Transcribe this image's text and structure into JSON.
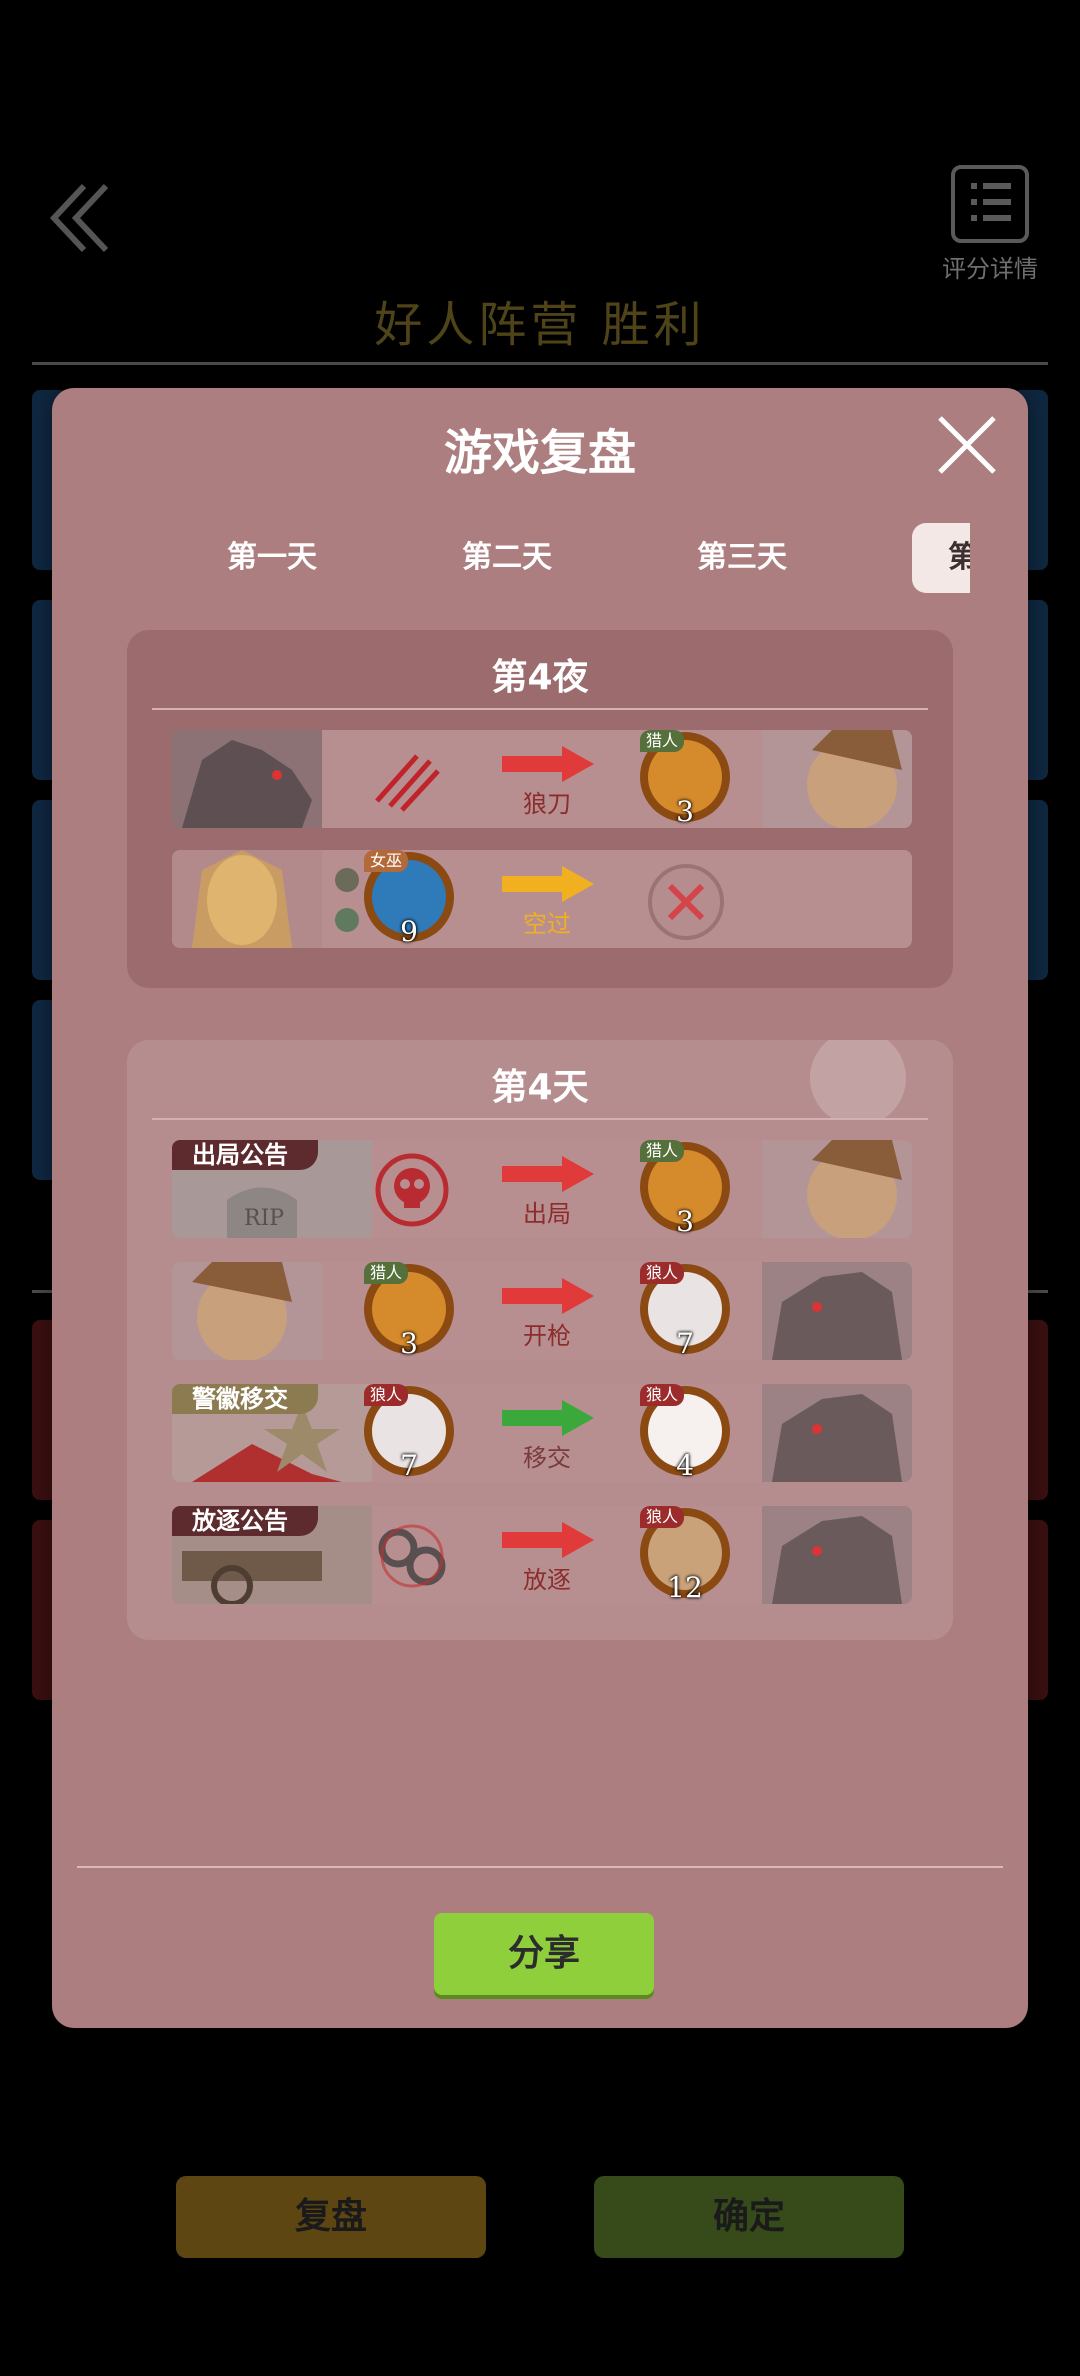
{
  "background": {
    "score_details_label": "评分详情",
    "result_title": "好人阵营  胜利",
    "review_button": "复盘",
    "confirm_button": "确定"
  },
  "modal": {
    "title": "游戏复盘",
    "tabs": [
      "第一天",
      "第二天",
      "第三天",
      "第四天"
    ],
    "active_tab": "第四天",
    "night": {
      "title": "第4夜",
      "rows": [
        {
          "action": "狼刀",
          "target_role": "猎人",
          "target_number": "3",
          "arrow_color": "#e03a3a"
        },
        {
          "actor_role": "女巫",
          "actor_number": "9",
          "action": "空过",
          "arrow_color": "#f0b020"
        }
      ]
    },
    "day": {
      "title": "第4天",
      "rows": [
        {
          "notice": "出局公告",
          "action": "出局",
          "target_role": "猎人",
          "target_number": "3",
          "arrow_color": "#e03a3a"
        },
        {
          "actor_role": "猎人",
          "actor_number": "3",
          "action": "开枪",
          "target_role": "狼人",
          "target_number": "7",
          "arrow_color": "#e03a3a"
        },
        {
          "notice": "警徽移交",
          "actor_role": "狼人",
          "actor_number": "7",
          "action": "移交",
          "target_role": "狼人",
          "target_number": "4",
          "arrow_color": "#3aa83a"
        },
        {
          "notice": "放逐公告",
          "action": "放逐",
          "target_role": "狼人",
          "target_number": "12",
          "arrow_color": "#e03a3a"
        }
      ]
    },
    "share_button": "分享"
  }
}
